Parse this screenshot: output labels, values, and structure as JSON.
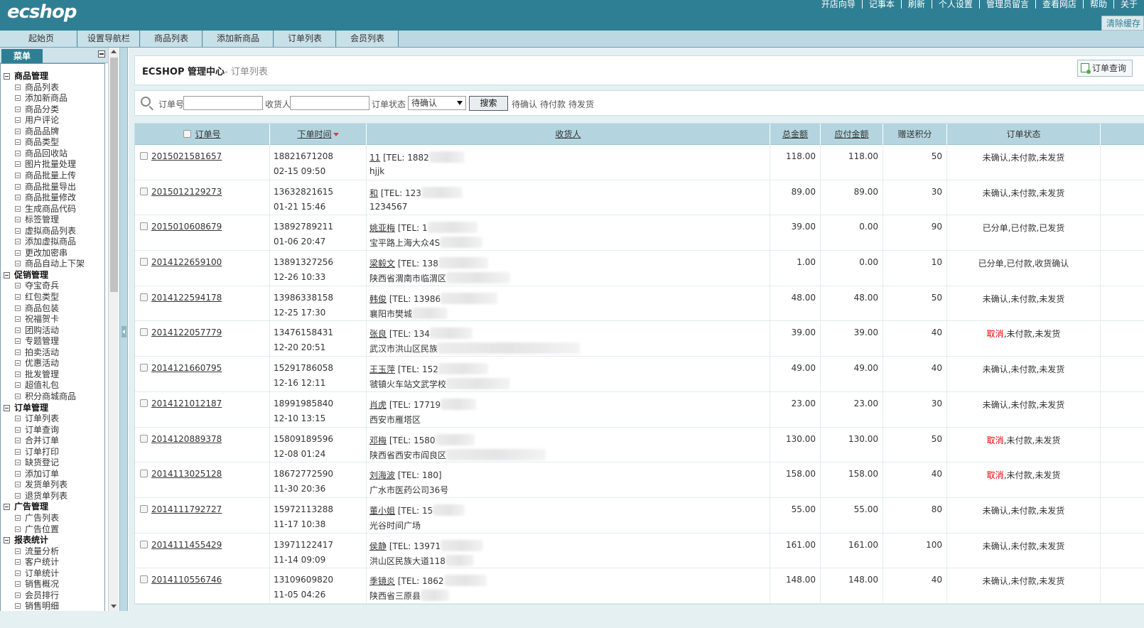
{
  "app": {
    "logo": "ecshop",
    "top_links": [
      "开店向导",
      "记事本",
      "刷新",
      "个人设置",
      "管理员留言",
      "查看网店",
      "帮助",
      "关于"
    ],
    "clear_cache": "清除缓存"
  },
  "nav_tabs": [
    "起始页",
    "设置导航栏",
    "商品列表",
    "添加新商品",
    "订单列表",
    "会员列表"
  ],
  "menu": {
    "tab_label": "菜单",
    "groups": [
      {
        "label": "商品管理",
        "items": [
          "商品列表",
          "添加新商品",
          "商品分类",
          "用户评论",
          "商品品牌",
          "商品类型",
          "商品回收站",
          "图片批量处理",
          "商品批量上传",
          "商品批量导出",
          "商品批量修改",
          "生成商品代码",
          "标签管理",
          "虚拟商品列表",
          "添加虚拟商品",
          "更改加密串",
          "商品自动上下架"
        ]
      },
      {
        "label": "促销管理",
        "items": [
          "夺宝奇兵",
          "红包类型",
          "商品包装",
          "祝福贺卡",
          "团购活动",
          "专题管理",
          "拍卖活动",
          "优惠活动",
          "批发管理",
          "超值礼包",
          "积分商城商品"
        ]
      },
      {
        "label": "订单管理",
        "items": [
          "订单列表",
          "订单查询",
          "合并订单",
          "订单打印",
          "缺货登记",
          "添加订单",
          "发货单列表",
          "退货单列表"
        ]
      },
      {
        "label": "广告管理",
        "items": [
          "广告列表",
          "广告位置"
        ]
      },
      {
        "label": "报表统计",
        "items": [
          "流量分析",
          "客户统计",
          "订单统计",
          "销售概况",
          "会员排行",
          "销售明细"
        ]
      }
    ]
  },
  "page": {
    "title": "ECSHOP 管理中心",
    "subtitle": "- 订单列表",
    "action_button": "订单查询"
  },
  "search": {
    "order_no_label": "订单号",
    "consignee_label": "收货人",
    "status_label": "订单状态",
    "status_value": "待确认",
    "search_button": "搜索",
    "quick_filters": [
      "待确认",
      "待付款",
      "待发货"
    ]
  },
  "table": {
    "headers": {
      "order_no": "订单号",
      "order_time": "下单时间",
      "consignee": "收货人",
      "total": "总金额",
      "payable": "应付金额",
      "points": "赠送积分",
      "status": "订单状态"
    },
    "rows": [
      {
        "order_no": "2015021581657",
        "user": "18821671208",
        "time": "02-15 09:50",
        "name": "11",
        "tel": "[TEL: 1882",
        "addr": "hjjk",
        "total": "118.00",
        "payable": "118.00",
        "points": "50",
        "status_prefix": "",
        "status": "未确认,未付款,未发货"
      },
      {
        "order_no": "2015012129273",
        "user": "13632821615",
        "time": "01-21 15:46",
        "name": "和",
        "tel": "[TEL: 123",
        "addr": "1234567",
        "total": "89.00",
        "payable": "89.00",
        "points": "30",
        "status_prefix": "",
        "status": "未确认,未付款,未发货"
      },
      {
        "order_no": "2015010608679",
        "user": "13892789211",
        "time": "01-06 20:47",
        "name": "姚亚梅",
        "tel": "[TEL: 1",
        "addr": "宝平路上海大众4S",
        "total": "39.00",
        "payable": "0.00",
        "points": "90",
        "status_prefix": "",
        "status": "已分单,已付款,已发货"
      },
      {
        "order_no": "2014122659100",
        "user": "13891327256",
        "time": "12-26 10:33",
        "name": "梁毅文",
        "tel": "[TEL: 138",
        "addr": "陕西省渭南市临渭区",
        "total": "1.00",
        "payable": "0.00",
        "points": "10",
        "status_prefix": "",
        "status": "已分单,已付款,收货确认"
      },
      {
        "order_no": "2014122594178",
        "user": "13986338158",
        "time": "12-25 17:30",
        "name": "韩俊",
        "tel": "[TEL: 13986",
        "addr": "襄阳市樊城",
        "total": "48.00",
        "payable": "48.00",
        "points": "50",
        "status_prefix": "",
        "status": "未确认,未付款,未发货"
      },
      {
        "order_no": "2014122057779",
        "user": "13476158431",
        "time": "12-20 20:51",
        "name": "张良",
        "tel": "[TEL: 134",
        "addr": "武汉市洪山区民族",
        "total": "39.00",
        "payable": "39.00",
        "points": "40",
        "status_prefix": "取消",
        "status": ",未付款,未发货"
      },
      {
        "order_no": "2014121660795",
        "user": "15291786058",
        "time": "12-16 12:11",
        "name": "王玉萍",
        "tel": "[TEL: 152",
        "addr": "虢镇火车站文武学校",
        "total": "49.00",
        "payable": "49.00",
        "points": "40",
        "status_prefix": "",
        "status": "未确认,未付款,未发货"
      },
      {
        "order_no": "2014121012187",
        "user": "18991985840",
        "time": "12-10 13:15",
        "name": "肖虎",
        "tel": "[TEL: 17719",
        "addr": "西安市雁塔区",
        "total": "23.00",
        "payable": "23.00",
        "points": "30",
        "status_prefix": "",
        "status": "未确认,未付款,未发货"
      },
      {
        "order_no": "2014120889378",
        "user": "15809189596",
        "time": "12-08 01:24",
        "name": "邓梅",
        "tel": "[TEL: 1580",
        "addr": "陕西省西安市阎良区",
        "total": "130.00",
        "payable": "130.00",
        "points": "50",
        "status_prefix": "取消",
        "status": ",未付款,未发货"
      },
      {
        "order_no": "2014113025128",
        "user": "18672772590",
        "time": "11-30 20:36",
        "name": "刘海波",
        "tel": "[TEL: 18",
        "tel_tail": "0]",
        "addr": "广水市医药公司36号",
        "total": "158.00",
        "payable": "158.00",
        "points": "40",
        "status_prefix": "取消",
        "status": ",未付款,未发货"
      },
      {
        "order_no": "2014111792727",
        "user": "15972113288",
        "time": "11-17 10:38",
        "name": "董小姐",
        "tel": "[TEL: 15",
        "addr": "光谷时间广场",
        "total": "55.00",
        "payable": "55.00",
        "points": "80",
        "status_prefix": "",
        "status": "未确认,未付款,未发货"
      },
      {
        "order_no": "2014111455429",
        "user": "13971122417",
        "time": "11-14 09:09",
        "name": "侯静",
        "tel": "[TEL: 13971",
        "addr": "洪山区民族大道118",
        "total": "161.00",
        "payable": "161.00",
        "points": "100",
        "status_prefix": "",
        "status": "未确认,未付款,未发货"
      },
      {
        "order_no": "2014110556746",
        "user": "13109609820",
        "time": "11-05 04:26",
        "name": "季镜炎",
        "tel": "[TEL: 1862",
        "addr": "陕西省三原县",
        "total": "148.00",
        "payable": "148.00",
        "points": "40",
        "status_prefix": "",
        "status": "未确认,未付款,未发货"
      }
    ]
  },
  "colors": {
    "header": "#2f7f94",
    "table_header": "#b4d5df",
    "cancel": "#e00000"
  }
}
